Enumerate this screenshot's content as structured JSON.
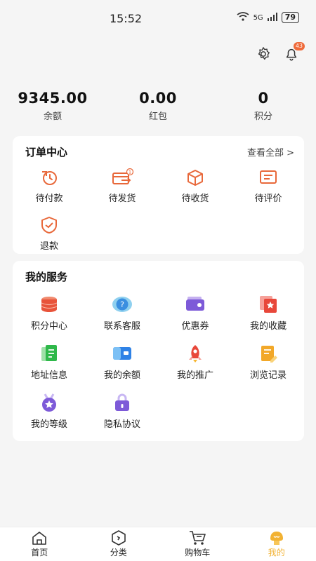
{
  "status": {
    "time": "15:52",
    "network": "5G",
    "battery": "79"
  },
  "header": {
    "notification_count": "43"
  },
  "stats": [
    {
      "value": "9345.00",
      "label": "余额"
    },
    {
      "value": "0.00",
      "label": "红包"
    },
    {
      "value": "0",
      "label": "积分"
    }
  ],
  "orders": {
    "title": "订单中心",
    "view_all": "查看全部 >",
    "items": [
      {
        "label": "待付款",
        "icon": "pending-payment-icon"
      },
      {
        "label": "待发货",
        "icon": "pending-shipment-icon",
        "badge": "1"
      },
      {
        "label": "待收货",
        "icon": "pending-receipt-icon"
      },
      {
        "label": "待评价",
        "icon": "pending-review-icon"
      },
      {
        "label": "退款",
        "icon": "refund-icon"
      }
    ]
  },
  "services": {
    "title": "我的服务",
    "items": [
      {
        "label": "积分中心",
        "icon": "points-center-icon"
      },
      {
        "label": "联系客服",
        "icon": "customer-service-icon"
      },
      {
        "label": "优惠券",
        "icon": "coupon-icon"
      },
      {
        "label": "我的收藏",
        "icon": "favorites-icon"
      },
      {
        "label": "地址信息",
        "icon": "address-icon"
      },
      {
        "label": "我的余额",
        "icon": "balance-icon"
      },
      {
        "label": "我的推广",
        "icon": "promotion-icon"
      },
      {
        "label": "浏览记录",
        "icon": "browse-history-icon"
      },
      {
        "label": "我的等级",
        "icon": "level-icon"
      },
      {
        "label": "隐私协议",
        "icon": "privacy-icon"
      }
    ]
  },
  "tabs": [
    {
      "label": "首页",
      "icon": "home-icon"
    },
    {
      "label": "分类",
      "icon": "category-icon"
    },
    {
      "label": "购物车",
      "icon": "cart-icon"
    },
    {
      "label": "我的",
      "icon": "profile-icon",
      "active": true
    }
  ],
  "colors": {
    "accent_orange": "#e8683a",
    "tab_active": "#f2b233",
    "card_bg": "#ffffff",
    "page_bg": "#f5f5f5"
  }
}
